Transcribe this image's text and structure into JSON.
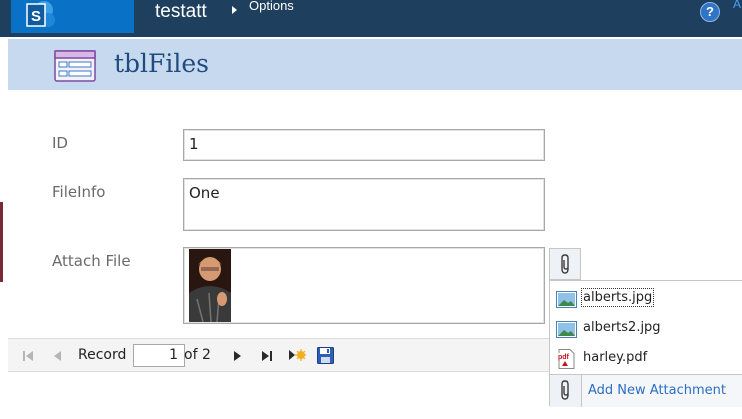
{
  "header": {
    "site_title": "testatt",
    "breadcrumb_item": "Options",
    "help_symbol": "?",
    "user_initial": "A",
    "logo_icon": "sharepoint-logo-icon",
    "colors": {
      "topbar": "#1f3f5f",
      "logo_bg": "#0a72c6"
    }
  },
  "form": {
    "table_name": "tblFiles",
    "table_icon": "table-form-icon",
    "fields": {
      "id": {
        "label": "ID",
        "value": "1"
      },
      "fileinfo": {
        "label": "FileInfo",
        "value": "One"
      },
      "attach": {
        "label": "Attach File"
      }
    }
  },
  "attachments": {
    "items": [
      {
        "name": "alberts.jpg",
        "icon": "image-file-icon"
      },
      {
        "name": "alberts2.jpg",
        "icon": "image-file-icon"
      },
      {
        "name": "harley.pdf",
        "icon": "pdf-file-icon"
      }
    ],
    "add_label": "Add New Attachment"
  },
  "navigation": {
    "record_label": "Record",
    "current_record": "1",
    "of_text": "of 2"
  }
}
